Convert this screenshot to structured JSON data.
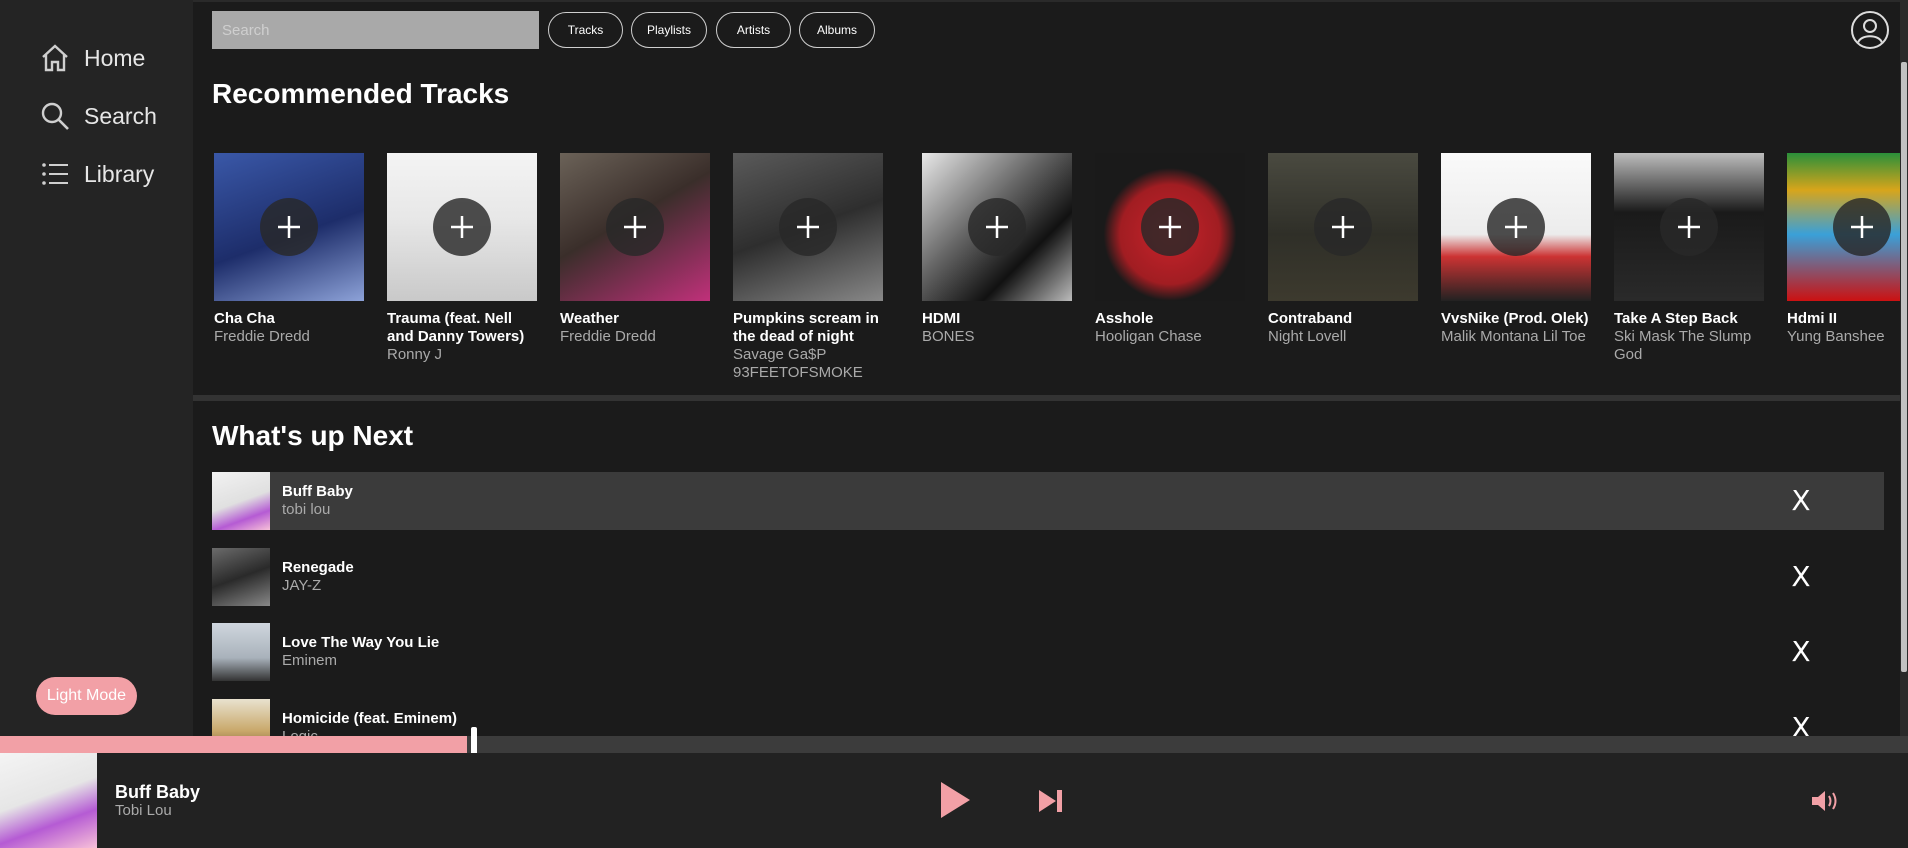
{
  "sidebar": {
    "items": [
      {
        "label": "Home",
        "icon": "home-icon"
      },
      {
        "label": "Search",
        "icon": "search-icon"
      },
      {
        "label": "Library",
        "icon": "list-icon"
      }
    ],
    "light_mode_label": "Light Mode"
  },
  "header": {
    "search_placeholder": "Search",
    "filters": [
      "Tracks",
      "Playlists",
      "Artists",
      "Albums"
    ],
    "profile_icon": "user-icon"
  },
  "recommended": {
    "title": "Recommended Tracks",
    "tracks": [
      {
        "title": "Cha Cha",
        "artist": "Freddie Dredd"
      },
      {
        "title": "Trauma (feat. Nell and Danny Towers)",
        "artist": "Ronny J"
      },
      {
        "title": "Weather",
        "artist": "Freddie Dredd"
      },
      {
        "title": "Pumpkins scream in the dead of night",
        "artist": "Savage Ga$P 93FEETOFSMOKE"
      },
      {
        "title": "HDMI",
        "artist": "BONES"
      },
      {
        "title": "Asshole",
        "artist": "Hooligan Chase"
      },
      {
        "title": "Contraband",
        "artist": "Night Lovell"
      },
      {
        "title": "VvsNike (Prod. Olek)",
        "artist": "Malik Montana Lil Toe"
      },
      {
        "title": "Take A Step Back",
        "artist": "Ski Mask The Slump God"
      },
      {
        "title": "Hdmi II",
        "artist": "Yung Banshee"
      }
    ]
  },
  "queue": {
    "title": "What's up Next",
    "remove_label": "X",
    "items": [
      {
        "title": "Buff Baby",
        "artist": "tobi lou"
      },
      {
        "title": "Renegade",
        "artist": "JAY-Z"
      },
      {
        "title": "Love The Way You Lie",
        "artist": "Eminem"
      },
      {
        "title": "Homicide (feat. Eminem)",
        "artist": "Logic"
      }
    ]
  },
  "player": {
    "title": "Buff Baby",
    "artist": "Tobi Lou",
    "progress": 0.245,
    "accent_color": "#f2a0a6"
  }
}
